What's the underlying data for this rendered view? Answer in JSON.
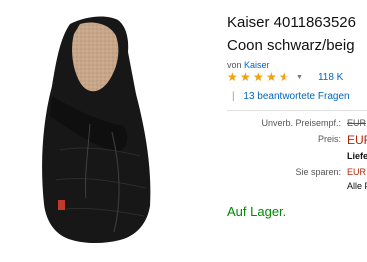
{
  "product": {
    "title_line1": "Kaiser 4011863526",
    "title_line2": "Coon schwarz/beig",
    "by_prefix": "von",
    "brand": "Kaiser",
    "rating": 4.5,
    "review_count": "118 K",
    "qa_separator": "|",
    "qa_link": "13 beantwortete Fragen"
  },
  "price_block": {
    "list_label": "Unverb. Preisempf.:",
    "list_value": "EUR",
    "price_label": "Preis:",
    "price_value": "EUR",
    "delivery_value": "Liefer",
    "savings_label": "Sie sparen:",
    "savings_value": "EUR",
    "all_prices_value": "Alle P"
  },
  "availability": {
    "text": "Auf Lager."
  },
  "icons": {
    "star": "star-icon",
    "dropdown": "caret-down-icon"
  },
  "colors": {
    "link": "#0066c0",
    "price": "#b12704",
    "in_stock": "#008a00",
    "star": "#f0a10b"
  }
}
